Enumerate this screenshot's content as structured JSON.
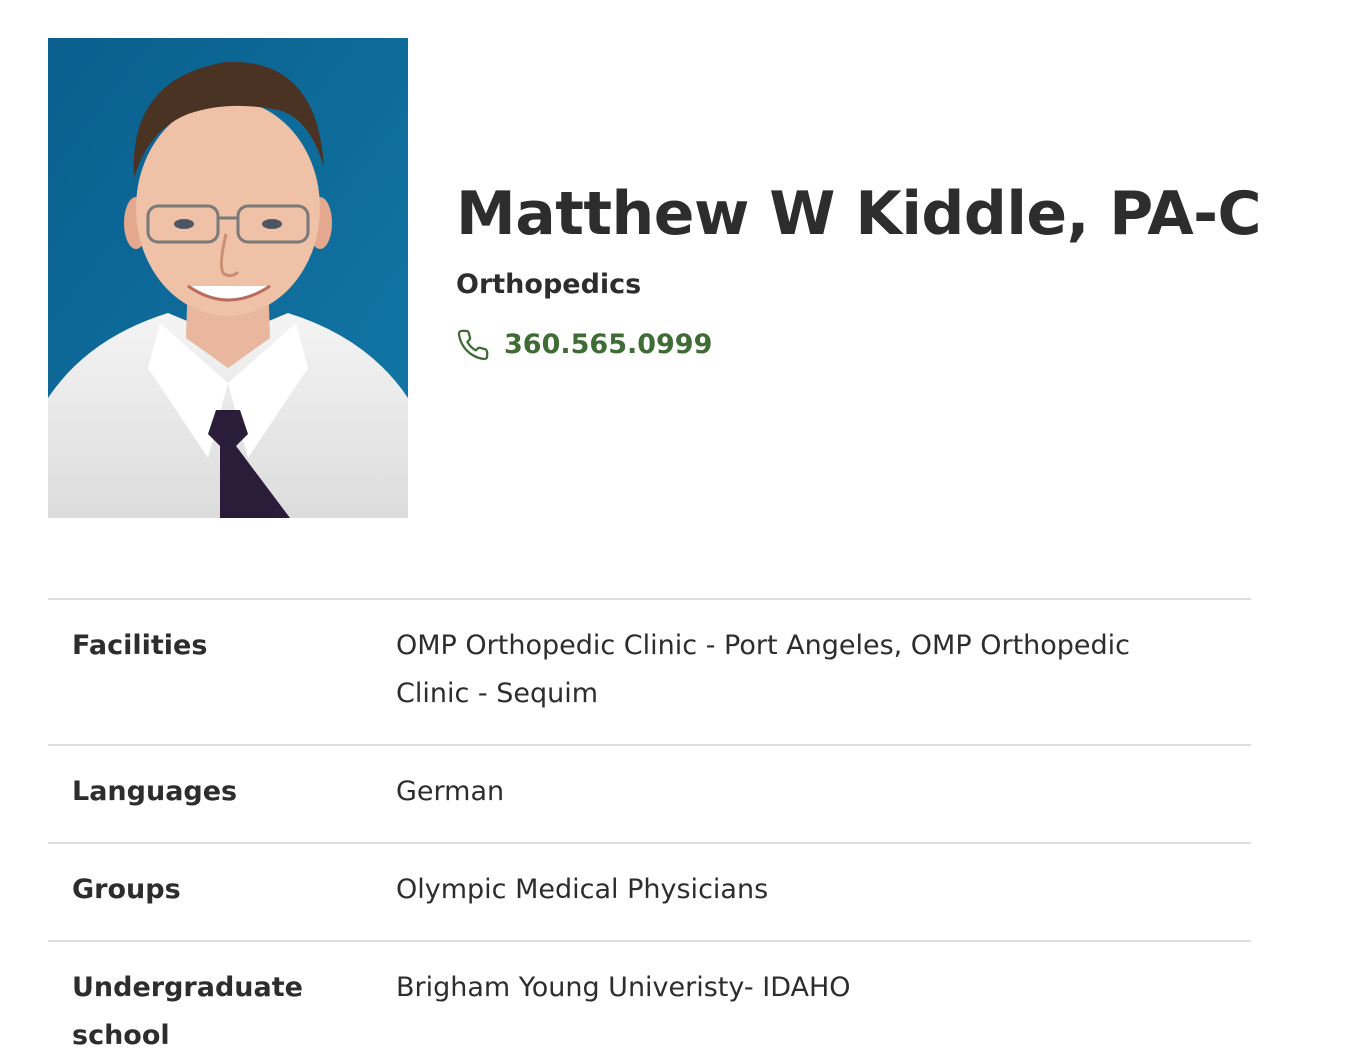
{
  "provider": {
    "name": "Matthew W Kiddle, PA-C",
    "specialty": "Orthopedics",
    "phone": "360.565.0999"
  },
  "details": [
    {
      "label": "Facilities",
      "value": "OMP Orthopedic Clinic - Port Angeles, OMP Orthopedic Clinic - Sequim"
    },
    {
      "label": "Languages",
      "value": "German"
    },
    {
      "label": "Groups",
      "value": "Olympic Medical Physicians"
    },
    {
      "label": "Undergraduate school",
      "value": "Brigham Young Univeristy- IDAHO"
    }
  ],
  "icons": {
    "phone": "phone-icon"
  },
  "colors": {
    "accent_green": "#3f6b35",
    "photo_background": "#0f6d99",
    "divider": "#dedede",
    "text": "#2d2d2d"
  }
}
